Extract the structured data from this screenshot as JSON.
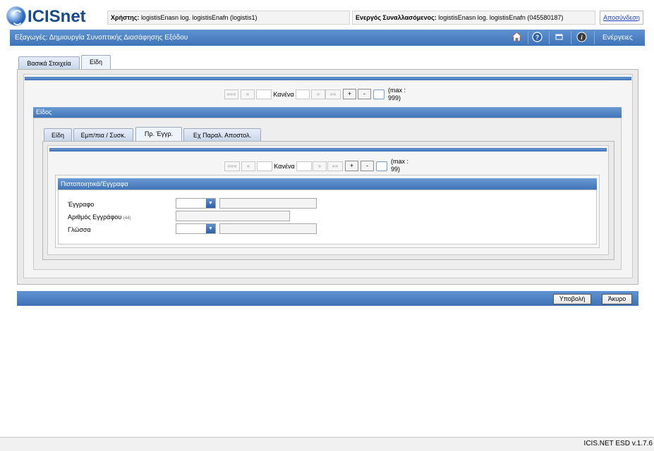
{
  "app": {
    "logo_text": "ICISnet"
  },
  "header": {
    "user_label": "Χρήστης:",
    "user_value": "logistisEnasn log. logistisEnafn (logistis1)",
    "trader_label": "Ενεργός Συναλλασόμενος:",
    "trader_value": "logistisEnasn log. logistisEnafn (045580187)",
    "logout": "Αποσύνδεση"
  },
  "titlebar": {
    "title": "Εξαγωγές: Δημιουργία Συνοπτικής Διασάφησης Εξόδου",
    "actions": "Ενέργειες"
  },
  "outer_tabs": [
    {
      "label": "Βασικά Στοιχεία"
    },
    {
      "label": "Είδη"
    }
  ],
  "pager_outer": {
    "first": "«««",
    "prev": "«",
    "current": "Κανένα",
    "next": "»",
    "last": "»»",
    "add": "+",
    "remove": "-",
    "max_line1": "(max :",
    "max_line2": "999)"
  },
  "items_section": {
    "title": "Είδος"
  },
  "inner_tabs": [
    {
      "label": "Είδη"
    },
    {
      "label": "Εμπ/πια / Συσκ."
    },
    {
      "label": "Πρ. Έγγρ."
    },
    {
      "label": "Εχ Παραλ. Αποστολ."
    }
  ],
  "pager_inner": {
    "first": "«««",
    "prev": "«",
    "current": "Κανένα",
    "next": "»",
    "last": "»»",
    "add": "+",
    "remove": "-",
    "max_line1": "(max :",
    "max_line2": "99)"
  },
  "docs_section": {
    "title": "Πιστοποιητικά/Έγγραφα",
    "fields": {
      "document": {
        "label": "Έγγραφο",
        "value": ""
      },
      "doc_number": {
        "label": "Αριθμός Εγγράφου",
        "hint": "(44)",
        "value": ""
      },
      "language": {
        "label": "Γλώσσα",
        "value": ""
      }
    }
  },
  "footer": {
    "submit": "Υποβολή",
    "cancel": "Άκυρο"
  },
  "status": {
    "version": "ICIS.NET ESD v.1.7.6"
  }
}
